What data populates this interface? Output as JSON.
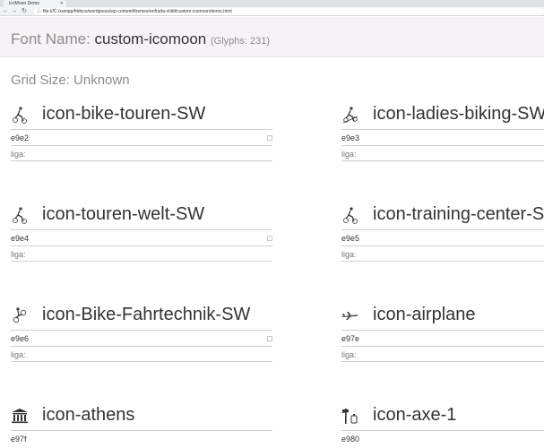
{
  "browser": {
    "tab_title": "IcoMoon Demo",
    "url": "file:///C:/xampp/htdocs/wordpress/wp-content/themes/enfrada-child/custom-icomoon/demo.html"
  },
  "header": {
    "font_name_label": "Font Name:",
    "font_name_value": "custom-icomoon",
    "glyph_count": "(Glyphs: 231)"
  },
  "grid_size": "Grid Size: Unknown",
  "glyphs": [
    {
      "name": "icon-bike-touren-SW",
      "code": "e9e2",
      "liga": "liga:",
      "icon": "cyclist-icon"
    },
    {
      "name": "icon-ladies-biking-SW",
      "code": "e9e3",
      "liga": "liga:",
      "icon": "cyclist-icon"
    },
    {
      "name": "icon-touren-welt-SW",
      "code": "e9e4",
      "liga": "liga:",
      "icon": "cyclist-icon"
    },
    {
      "name": "icon-training-center-SW",
      "code": "e9e5",
      "liga": "liga:",
      "icon": "cyclist-icon"
    },
    {
      "name": "icon-Bike-Fahrtechnik-SW",
      "code": "e9e6",
      "liga": "liga:",
      "icon": "cyclist-jump-icon"
    },
    {
      "name": "icon-airplane",
      "code": "e97e",
      "liga": "liga:",
      "icon": "airplane-icon"
    },
    {
      "name": "icon-athens",
      "code": "e97f",
      "liga": "",
      "icon": "temple-icon"
    },
    {
      "name": "icon-axe-1",
      "code": "e980",
      "liga": "",
      "icon": "axe-icon"
    }
  ]
}
